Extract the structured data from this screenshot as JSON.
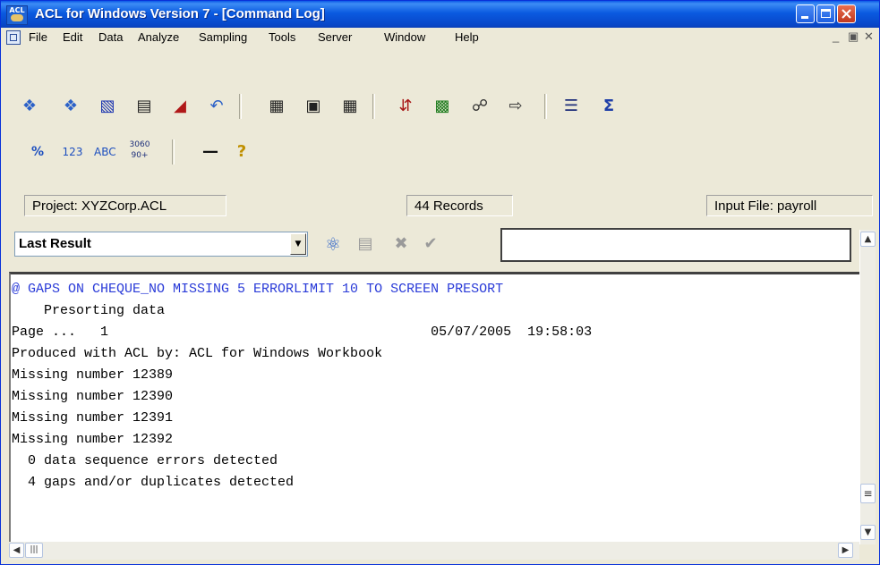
{
  "window": {
    "title": "ACL for Windows Version 7 - [Command Log]",
    "app_icon_text": "ACL"
  },
  "menu": {
    "items": [
      "File",
      "Edit",
      "Data",
      "Analyze",
      "Sampling",
      "Tools",
      "Server",
      "Window",
      "Help"
    ]
  },
  "status": {
    "project": "Project: XYZCorp.ACL",
    "records": "44 Records",
    "input_file": "Input File: payroll"
  },
  "result_bar": {
    "selected": "Last Result",
    "command_input_value": ""
  },
  "log": {
    "command": "@ GAPS ON CHEQUE_NO MISSING 5 ERRORLIMIT 10 TO SCREEN PRESORT",
    "lines": [
      "    Presorting data",
      "Page ...   1                                        05/07/2005  19:58:03",
      "Produced with ACL by: ACL for Windows Workbook",
      "Missing number 12389",
      "Missing number 12390",
      "Missing number 12391",
      "Missing number 12392",
      "  0 data sequence errors detected",
      "  4 gaps and/or duplicates detected"
    ]
  },
  "toolbar1": {
    "icons": [
      "open-project-icon",
      "open-table-icon",
      "save-icon",
      "print-icon",
      "set-filter-icon",
      "undo-icon",
      "table-layout-icon",
      "view-icon",
      "grid-icon",
      "sort-icon",
      "index-icon",
      "relate-icon",
      "join-icon",
      "count-icon",
      "total-icon"
    ]
  },
  "toolbar2": {
    "icons": [
      "stratify-icon",
      "classify-icon",
      "characters-icon",
      "age-icon",
      "separator-line-icon",
      "help-icon"
    ]
  },
  "colors": {
    "command_text": "#2a3bd8",
    "titlebar": "#0a58e6"
  }
}
